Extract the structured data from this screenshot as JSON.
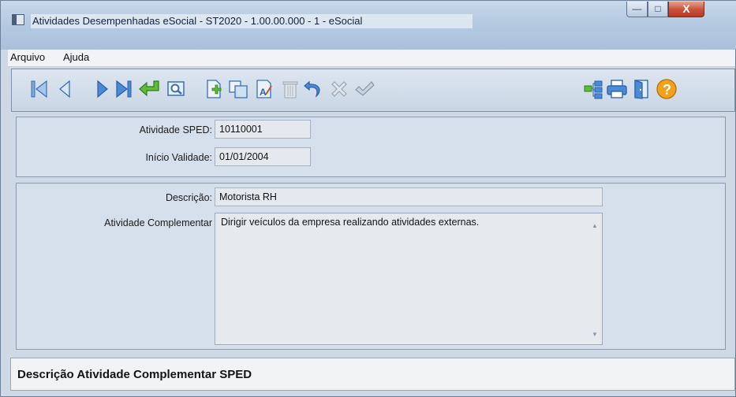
{
  "window": {
    "title": "Atividades Desempenhadas eSocial - ST2020 - 1.00.00.000 - 1 - eSocial",
    "minimize_glyph": "—",
    "maximize_glyph": "□",
    "close_glyph": "X"
  },
  "menu": {
    "items": [
      {
        "label": "Arquivo"
      },
      {
        "label": "Ajuda"
      }
    ]
  },
  "toolbar": {
    "buttons": [
      {
        "icon": "first-record-icon"
      },
      {
        "icon": "previous-record-icon"
      },
      {
        "icon": "next-record-icon"
      },
      {
        "icon": "last-record-icon"
      },
      {
        "icon": "return-arrow-icon"
      },
      {
        "icon": "search-icon"
      },
      {
        "icon": "new-record-icon"
      },
      {
        "icon": "copy-icon"
      },
      {
        "icon": "edit-icon"
      },
      {
        "icon": "delete-icon"
      },
      {
        "icon": "undo-icon"
      },
      {
        "icon": "cancel-icon"
      },
      {
        "icon": "confirm-icon"
      },
      {
        "icon": "tree-icon"
      },
      {
        "icon": "print-icon"
      },
      {
        "icon": "exit-door-icon"
      },
      {
        "icon": "help-icon"
      }
    ]
  },
  "form": {
    "atividade_sped": {
      "label": "Atividade SPED:",
      "value": "10110001"
    },
    "inicio_validade": {
      "label": "Início Validade:",
      "value": "01/01/2004"
    },
    "descricao": {
      "label": "Descrição:",
      "value": "Motorista RH"
    },
    "atividade_complementar": {
      "label": "Atividade Complementar",
      "value": "Dirigir veículos da empresa realizando atividades externas."
    }
  },
  "status": {
    "message": "Descrição Atividade Complementar SPED"
  },
  "colors": {
    "accent_blue": "#3a78c8",
    "green_arrow": "#4aa82c",
    "help_orange": "#f2a21a",
    "close_red": "#c8503a"
  }
}
